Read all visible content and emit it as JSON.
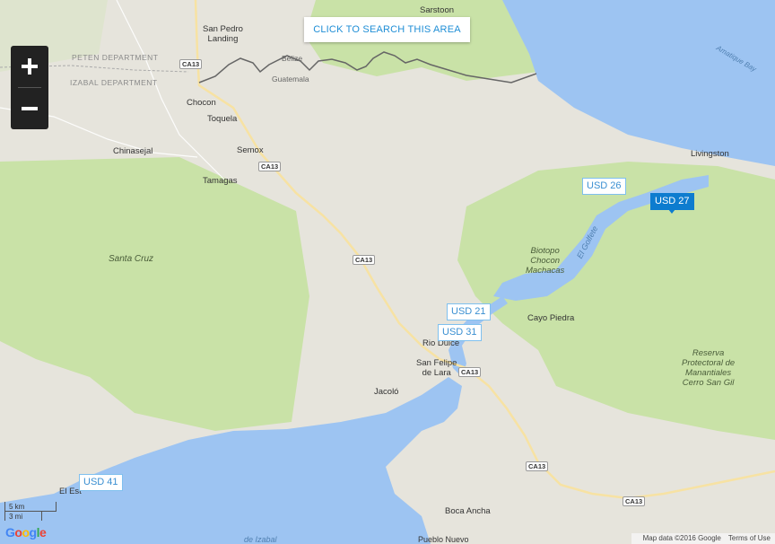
{
  "map": {
    "search_button": "CLICK TO SEARCH THIS AREA",
    "zoom": {
      "in": "+",
      "out": "−"
    },
    "price_markers": [
      {
        "label": "USD 26",
        "active": false
      },
      {
        "label": "USD 27",
        "active": true
      },
      {
        "label": "USD 21",
        "active": false
      },
      {
        "label": "USD 31",
        "active": false
      },
      {
        "label": "USD 41",
        "active": false
      }
    ],
    "places": {
      "sarstoon": "Sarstoon",
      "san_pedro_1": "San Pedro",
      "san_pedro_2": "Landing",
      "peten": "PETEN DEPARTMENT",
      "izabal": "IZABAL DEPARTMENT",
      "belize": "Belize",
      "guatemala": "Guatemala",
      "chocon": "Chocon",
      "toquela": "Toquela",
      "chinasejal": "Chinasejal",
      "semox": "Semox",
      "tamagas": "Tamagas",
      "santa_cruz": "Santa Cruz",
      "livingston": "Livingston",
      "amatique_bay": "Amatique Bay",
      "biotopo_1": "Biotopo",
      "biotopo_2": "Chocon",
      "biotopo_3": "Machacas",
      "el_golfete": "El Golfete",
      "cayo_piedra": "Cayo Piedra",
      "rio_dulce": "Rio Dulce",
      "san_felipe_1": "San Felipe",
      "san_felipe_2": "de Lara",
      "jacolo": "Jacoló",
      "reserva_1": "Reserva",
      "reserva_2": "Protectoral de",
      "reserva_3": "Manantiales",
      "reserva_4": "Cerro San Gil",
      "el_estor": "El Est",
      "boca_ancha": "Boca Ancha",
      "pueblo_nuevo": "Pueblo Nuevo",
      "lago_izabal": "de Izabal"
    },
    "road_shield": "CA13",
    "scale": {
      "km": "5 km",
      "mi": "3 mi"
    },
    "attribution": {
      "data": "Map data ©2016 Google",
      "terms": "Terms of Use"
    },
    "google_logo": "Google",
    "colors": {
      "land": "#e6e4dc",
      "forest": "#c9e2a7",
      "water": "#9dc4f2",
      "accent": "#1f8ed6",
      "marker_active": "#0d7ccf"
    }
  }
}
